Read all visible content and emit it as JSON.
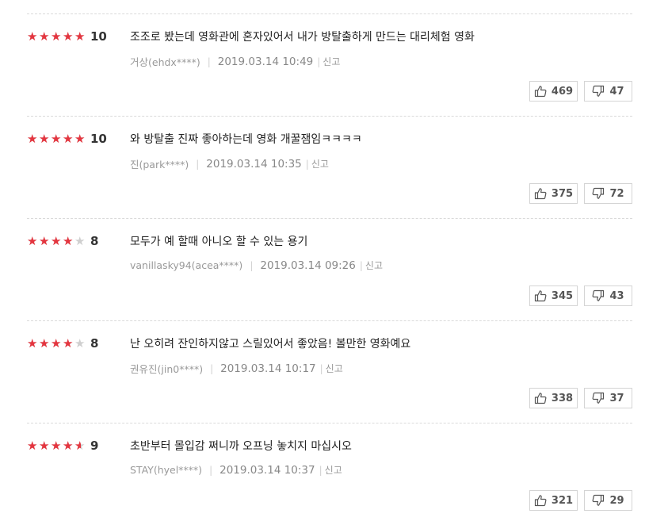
{
  "reviews": [
    {
      "rating": 5,
      "score": "10",
      "comment": "조조로 봤는데 영화관에 혼자있어서 내가 방탈출하게 만드는 대리체험 영화",
      "user": "거상(ehdx****)",
      "date": "2019.03.14 10:49",
      "report": "신고",
      "likes": "469",
      "dislikes": "47"
    },
    {
      "rating": 5,
      "score": "10",
      "comment": "와 방탈출 진짜 좋아하는데 영화 개꿀잼임ㅋㅋㅋㅋ",
      "user": "진(park****)",
      "date": "2019.03.14 10:35",
      "report": "신고",
      "likes": "375",
      "dislikes": "72"
    },
    {
      "rating": 4,
      "score": "8",
      "comment": "모두가 예 할때 아니오 할 수 있는 용기",
      "user": "vanillasky94(acea****)",
      "date": "2019.03.14 09:26",
      "report": "신고",
      "likes": "345",
      "dislikes": "43"
    },
    {
      "rating": 4,
      "score": "8",
      "comment": "난 오히려 잔인하지않고 스릴있어서 좋았음! 볼만한 영화예요",
      "user": "권유진(jin0****)",
      "date": "2019.03.14 10:17",
      "report": "신고",
      "likes": "338",
      "dislikes": "37"
    },
    {
      "rating": 4.5,
      "score": "9",
      "comment": "초반부터 몰입감 쩌니까 오프닝 놓치지 마십시오",
      "user": "STAY(hyel****)",
      "date": "2019.03.14 10:37",
      "report": "신고",
      "likes": "321",
      "dislikes": "29"
    }
  ],
  "colors": {
    "star_filled": "#e4353f",
    "star_empty": "#cfcfcf"
  },
  "icons": {
    "like": "thumbs-up-icon",
    "dislike": "thumbs-down-icon"
  }
}
